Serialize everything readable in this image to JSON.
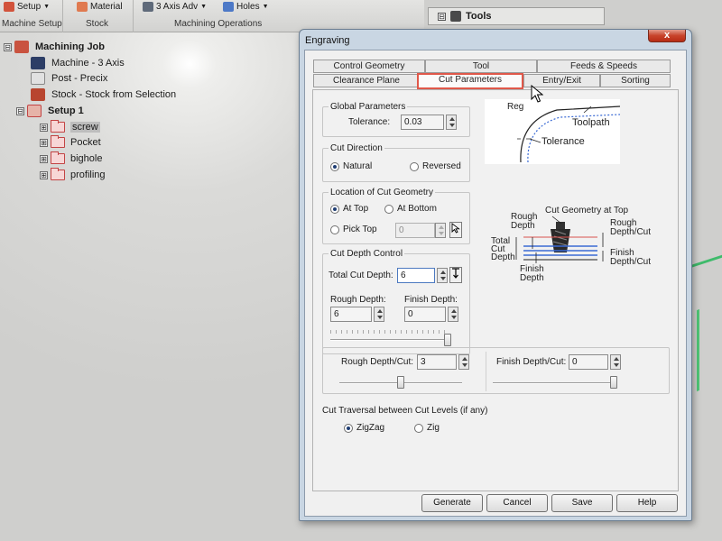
{
  "ribbon": {
    "items": [
      {
        "label": "Setup",
        "icon": "setup-icon"
      },
      {
        "label": "Material",
        "icon": "material-icon"
      },
      {
        "label": "3 Axis Adv",
        "icon": "3-axis-adv-icon"
      },
      {
        "label": "Holes",
        "icon": "holes-icon"
      }
    ],
    "groups": {
      "machine_setup": "Machine Setup",
      "stock": "Stock",
      "machining_operations": "Machining Operations"
    }
  },
  "tools_panel": {
    "box": "⊟",
    "title": "Tools"
  },
  "tree": {
    "root": "Machining Job",
    "machine": "Machine - 3 Axis",
    "post": "Post - Precix",
    "stock": "Stock - Stock from Selection",
    "setup": "Setup 1",
    "operations": [
      "screw",
      "Pocket",
      "bighole",
      "profiling"
    ],
    "expanders": {
      "collapse": "⊟",
      "expand": "⊞"
    }
  },
  "dialog": {
    "title": "Engraving",
    "close": "x",
    "tabs_row1": [
      "Control Geometry",
      "Tool",
      "Feeds & Speeds"
    ],
    "tabs_row2": [
      "Clearance Plane",
      "Cut Parameters",
      "Entry/Exit",
      "Sorting"
    ],
    "active_tab": "Cut Parameters",
    "global": {
      "title": "Global Parameters",
      "tolerance_label": "Tolerance:",
      "tolerance_value": "0.03"
    },
    "cut_direction": {
      "title": "Cut Direction",
      "natural": "Natural",
      "reversed": "Reversed",
      "selected": "Natural"
    },
    "location": {
      "title": "Location of Cut Geometry",
      "at_top": "At Top",
      "at_bottom": "At Bottom",
      "pick_top": "Pick Top",
      "pick_value": "0",
      "selected": "At Top"
    },
    "depth": {
      "title": "Cut Depth Control",
      "total_label": "Total Cut Depth:",
      "total_value": "6",
      "rough_label": "Rough Depth:",
      "rough_value": "6",
      "finish_label": "Finish Depth:",
      "finish_value": "0",
      "rough_slider_fraction": 1.0
    },
    "per_cut": {
      "rough_label": "Rough Depth/Cut:",
      "rough_value": "3",
      "rough_slider_fraction": 0.5,
      "finish_label": "Finish Depth/Cut:",
      "finish_value": "0",
      "finish_slider_fraction": 1.0
    },
    "traversal": {
      "title": "Cut Traversal between Cut Levels (if any)",
      "zigzag": "ZigZag",
      "zig": "Zig",
      "selected": "ZigZag"
    },
    "diagram_top": {
      "region": "Reg",
      "toolpath": "Toolpath",
      "tolerance": "Tolerance"
    },
    "diagram_bottom": {
      "cut_geometry_top": "Cut Geometry at Top",
      "rough_depth": [
        "Rough",
        "Depth"
      ],
      "total_cut_depth": [
        "Total",
        "Cut",
        "Depth"
      ],
      "finish_depth": [
        "Finish",
        "Depth"
      ],
      "rough_depth_cut": [
        "Rough",
        "Depth/Cut"
      ],
      "finish_depth_cut": [
        "Finish",
        "Depth/Cut"
      ]
    },
    "buttons": {
      "generate": "Generate",
      "cancel": "Cancel",
      "save": "Save",
      "help": "Help"
    }
  },
  "colors": {
    "dialog_frame": "#c9d6e3",
    "active_tab_border": "#e0584a",
    "close_button": "#c8442b",
    "selection_green": "#27b85a"
  }
}
